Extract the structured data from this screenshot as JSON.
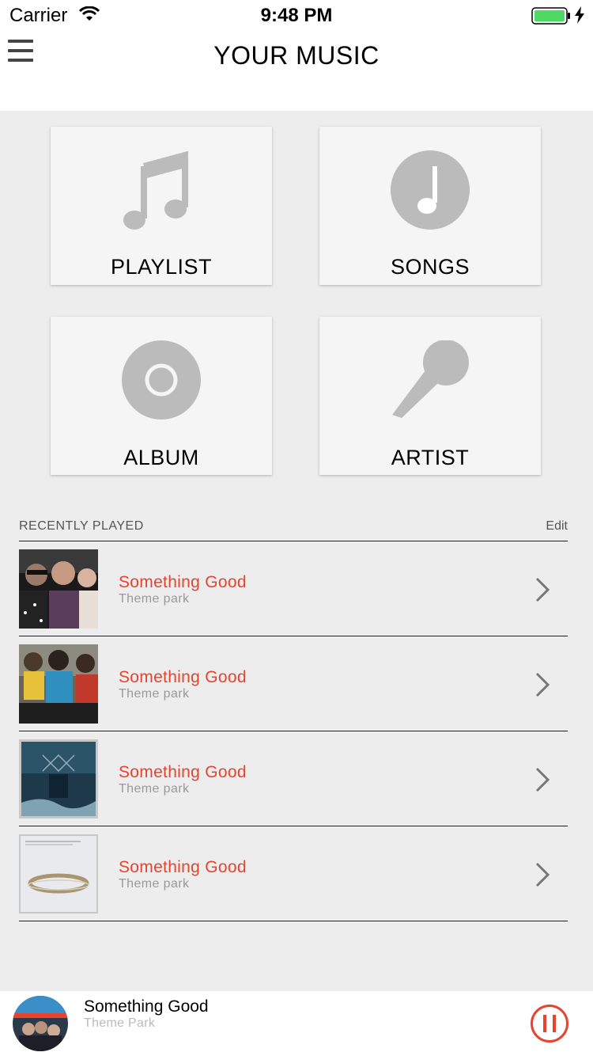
{
  "status_bar": {
    "carrier": "Carrier",
    "time": "9:48 PM",
    "battery_color": "#4cd964"
  },
  "header": {
    "title": "YOUR MUSIC",
    "menu_icon": "hamburger-menu-icon"
  },
  "categories": [
    {
      "label": "PLAYLIST",
      "icon": "music-notes-icon"
    },
    {
      "label": "SONGS",
      "icon": "music-note-circle-icon"
    },
    {
      "label": "ALBUM",
      "icon": "disc-icon"
    },
    {
      "label": "ARTIST",
      "icon": "microphone-icon"
    }
  ],
  "recently_played": {
    "title": "RECENTLY PLAYED",
    "edit_label": "Edit",
    "items": [
      {
        "title": "Something Good",
        "subtitle": "Theme park"
      },
      {
        "title": "Something Good",
        "subtitle": "Theme park"
      },
      {
        "title": "Something Good",
        "subtitle": "Theme park"
      },
      {
        "title": "Something Good",
        "subtitle": "Theme park"
      }
    ]
  },
  "player": {
    "title": "Something Good",
    "subtitle": "Theme Park",
    "accent_color": "#e8432e"
  },
  "colors": {
    "accent": "#e8432e",
    "icon_gray": "#bbbbbb",
    "background": "#ededed"
  }
}
